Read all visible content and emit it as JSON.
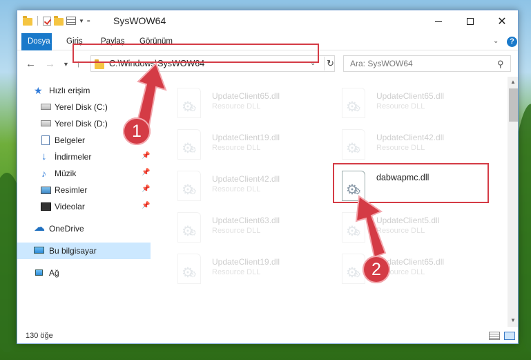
{
  "window": {
    "title": "SysWOW64"
  },
  "ribbon": {
    "tabs": [
      "Dosya",
      "Giriş",
      "Paylaş",
      "Görünüm"
    ]
  },
  "address": {
    "path": "C:\\Windows\\SysWOW64"
  },
  "search": {
    "placeholder": "Ara: SysWOW64"
  },
  "sidebar": {
    "items": [
      {
        "label": "Hızlı erişim",
        "icon": "star-icon"
      },
      {
        "label": "Yerel Disk (C:)",
        "icon": "disk-icon"
      },
      {
        "label": "Yerel Disk (D:)",
        "icon": "disk-icon"
      },
      {
        "label": "Belgeler",
        "icon": "documents-icon"
      },
      {
        "label": "İndirmeler",
        "icon": "download-icon",
        "pinned": true
      },
      {
        "label": "Müzik",
        "icon": "music-icon",
        "pinned": true
      },
      {
        "label": "Resimler",
        "icon": "pictures-icon",
        "pinned": true
      },
      {
        "label": "Videolar",
        "icon": "videos-icon",
        "pinned": true
      },
      {
        "label": "OneDrive",
        "icon": "onedrive-icon"
      },
      {
        "label": "Bu bilgisayar",
        "icon": "computer-icon",
        "selected": true
      },
      {
        "label": "Ağ",
        "icon": "network-icon"
      }
    ]
  },
  "files": [
    {
      "name": "UpdateClient65.dll",
      "type": "Resource DLL",
      "faded": true
    },
    {
      "name": "UpdateClient65.dll",
      "type": "Resource DLL",
      "faded": true
    },
    {
      "name": "UpdateClient19.dll",
      "type": "Resource DLL",
      "faded": true
    },
    {
      "name": "UpdateClient42.dll",
      "type": "Resource DLL",
      "faded": true
    },
    {
      "name": "UpdateClient42.dll",
      "type": "Resource DLL",
      "faded": true
    },
    {
      "name": "dabwapmc.dll",
      "type": "",
      "faded": false
    },
    {
      "name": "UpdateClient63.dll",
      "type": "Resource DLL",
      "faded": true
    },
    {
      "name": "UpdateClient5.dll",
      "type": "Resource DLL",
      "faded": true
    },
    {
      "name": "UpdateClient19.dll",
      "type": "Resource DLL",
      "faded": true
    },
    {
      "name": "UpdateClient65.dll",
      "type": "Resource DLL",
      "faded": true
    }
  ],
  "status": {
    "count": "130 öğe"
  },
  "annotations": {
    "badge1": "1",
    "badge2": "2",
    "color": "#d43b45"
  }
}
